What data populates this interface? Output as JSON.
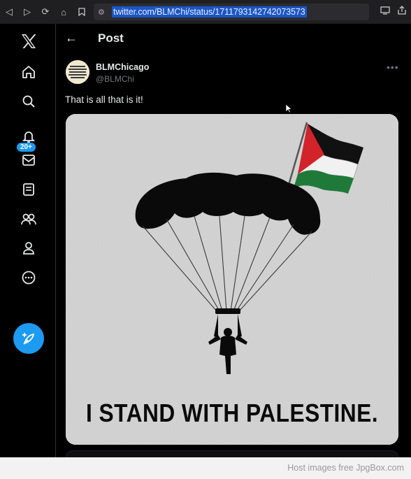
{
  "browser": {
    "url": "twitter.com/BLMChi/status/1711793142742073573"
  },
  "sidebar": {
    "notification_badge": "20+",
    "items": [
      {
        "name": "x-logo-icon"
      },
      {
        "name": "home-icon"
      },
      {
        "name": "search-icon"
      },
      {
        "name": "bell-icon"
      },
      {
        "name": "mail-icon"
      },
      {
        "name": "list-icon"
      },
      {
        "name": "communities-icon"
      },
      {
        "name": "profile-icon"
      },
      {
        "name": "more-circle-icon"
      }
    ]
  },
  "header": {
    "title": "Post"
  },
  "tweet": {
    "display_name": "BLMChicago",
    "handle": "@BLMChi",
    "text": "That is all that is it!",
    "image_caption": "I STAND WITH PALESTINE."
  },
  "footer": {
    "text": "Host images free JpgBox.com"
  },
  "colors": {
    "accent": "#1d9bf0",
    "background": "#000000",
    "flag_red": "#d2232a",
    "flag_green": "#1f7a3a"
  }
}
